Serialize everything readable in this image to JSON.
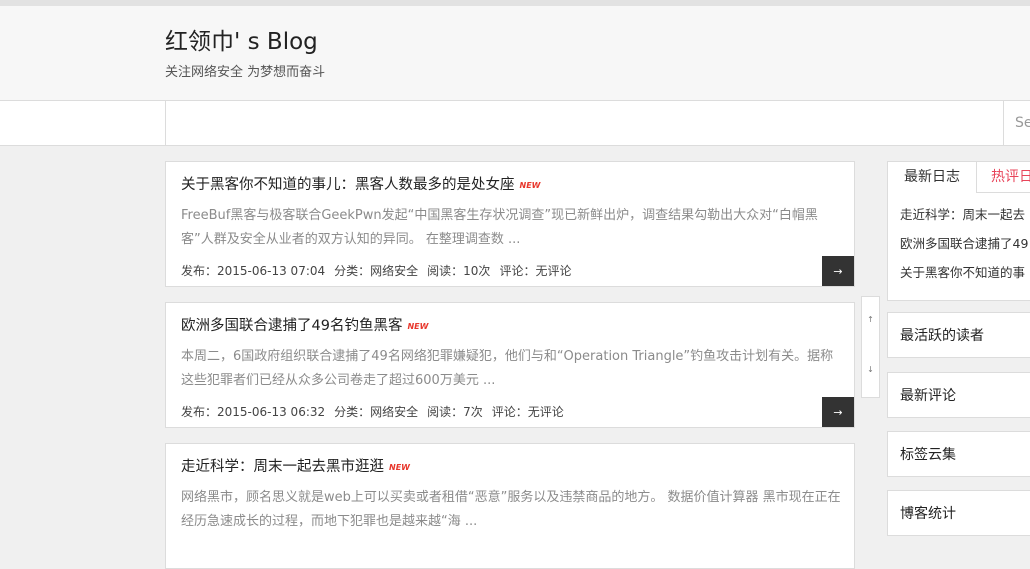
{
  "site": {
    "title": "红领巾' s Blog",
    "subtitle": "关注网络安全 为梦想而奋斗"
  },
  "search": {
    "placeholder": "Se"
  },
  "new_badge": "NEW",
  "more_icon": "arrow-right-icon",
  "posts": [
    {
      "title": "关于黑客你不知道的事儿：黑客人数最多的是处女座",
      "excerpt": "FreeBuf黑客与极客联合GeekPwn发起“中国黑客生存状况调查”现已新鲜出炉，调查结果勾勒出大众对“白帽黑客”人群及安全从业者的双方认知的异同。 在整理调查数 ...",
      "date": "发布：2015-06-13 07:04",
      "category": "分类：网络安全",
      "views": "阅读：10次",
      "comments": "评论：无评论",
      "more": "→"
    },
    {
      "title": "欧洲多国联合逮捕了49名钓鱼黑客",
      "excerpt": "本周二，6国政府组织联合逮捕了49名网络犯罪嫌疑犯，他们与和“Operation Triangle”钓鱼攻击计划有关。据称这些犯罪者们已经从众多公司卷走了超过600万美元 ...",
      "date": "发布：2015-06-13 06:32",
      "category": "分类：网络安全",
      "views": "阅读：7次",
      "comments": "评论：无评论",
      "more": "→"
    },
    {
      "title": "走近科学：周末一起去黑市逛逛",
      "excerpt": "网络黑市，顾名思义就是web上可以买卖或者租借“恶意”服务以及违禁商品的地方。 数据价值计算器 黑市现在正在经历急速成长的过程，而地下犯罪也是越来越“海 ..."
    }
  ],
  "pager": {
    "up": "↑",
    "down": "↓"
  },
  "sidebar": {
    "tabs": [
      "最新日志",
      "热评日"
    ],
    "recent": [
      "走近科学：周末一起去",
      "欧洲多国联合逮捕了49",
      "关于黑客你不知道的事"
    ],
    "widgets": [
      "最活跃的读者",
      "最新评论",
      "标签云集",
      "博客统计"
    ]
  }
}
